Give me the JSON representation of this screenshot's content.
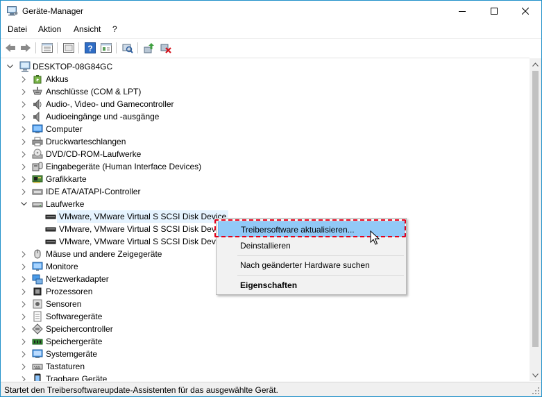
{
  "window": {
    "title": "Geräte-Manager"
  },
  "menu": [
    "Datei",
    "Aktion",
    "Ansicht",
    "?"
  ],
  "toolbar": [
    "back-icon",
    "forward-icon",
    "properties-view-icon",
    "show-hidden-icon",
    "help-icon",
    "toggle-pane-icon",
    "scan-hardware-icon",
    "update-driver-icon",
    "uninstall-device-icon"
  ],
  "tree": {
    "root": "DESKTOP-08G84GC",
    "categories": [
      {
        "label": "Akkus",
        "icon": "battery-icon"
      },
      {
        "label": "Anschlüsse (COM & LPT)",
        "icon": "port-icon"
      },
      {
        "label": "Audio-, Video- und Gamecontroller",
        "icon": "speaker-icon"
      },
      {
        "label": "Audioeingänge und -ausgänge",
        "icon": "audio-io-icon"
      },
      {
        "label": "Computer",
        "icon": "computer-icon"
      },
      {
        "label": "Druckwarteschlangen",
        "icon": "printer-icon"
      },
      {
        "label": "DVD/CD-ROM-Laufwerke",
        "icon": "dvd-drive-icon"
      },
      {
        "label": "Eingabegeräte (Human Interface Devices)",
        "icon": "hid-icon"
      },
      {
        "label": "Grafikkarte",
        "icon": "graphics-card-icon"
      },
      {
        "label": "IDE ATA/ATAPI-Controller",
        "icon": "ide-controller-icon"
      },
      {
        "label": "Laufwerke",
        "icon": "disk-drive-icon",
        "expanded": true,
        "children": [
          "VMware, VMware Virtual S SCSI Disk Device",
          "VMware, VMware Virtual S SCSI Disk Device",
          "VMware, VMware Virtual S SCSI Disk Device"
        ]
      },
      {
        "label": "Mäuse und andere Zeigegeräte",
        "icon": "mouse-icon"
      },
      {
        "label": "Monitore",
        "icon": "monitor-icon"
      },
      {
        "label": "Netzwerkadapter",
        "icon": "network-adapter-icon"
      },
      {
        "label": "Prozessoren",
        "icon": "processor-icon"
      },
      {
        "label": "Sensoren",
        "icon": "sensor-icon"
      },
      {
        "label": "Softwaregeräte",
        "icon": "software-device-icon"
      },
      {
        "label": "Speichercontroller",
        "icon": "storage-controller-icon"
      },
      {
        "label": "Speichergeräte",
        "icon": "memory-icon"
      },
      {
        "label": "Systemgeräte",
        "icon": "system-device-icon"
      },
      {
        "label": "Tastaturen",
        "icon": "keyboard-icon"
      },
      {
        "label": "Tragbare Geräte",
        "icon": "portable-device-icon"
      }
    ]
  },
  "context_menu": {
    "items": [
      {
        "label": "Treibersoftware aktualisieren...",
        "state": "hover"
      },
      {
        "label": "Deinstallieren"
      },
      {
        "label": "Nach geänderter Hardware suchen"
      },
      {
        "label": "Eigenschaften",
        "bold": true
      }
    ]
  },
  "status": "Startet den Treibersoftwareupdate-Assistenten für das ausgewählte Gerät.",
  "colors": {
    "accent": "#1e90c9",
    "hover": "#91c9f7",
    "highlight_box": "#e4001b",
    "selection": "#e5f3ff"
  }
}
